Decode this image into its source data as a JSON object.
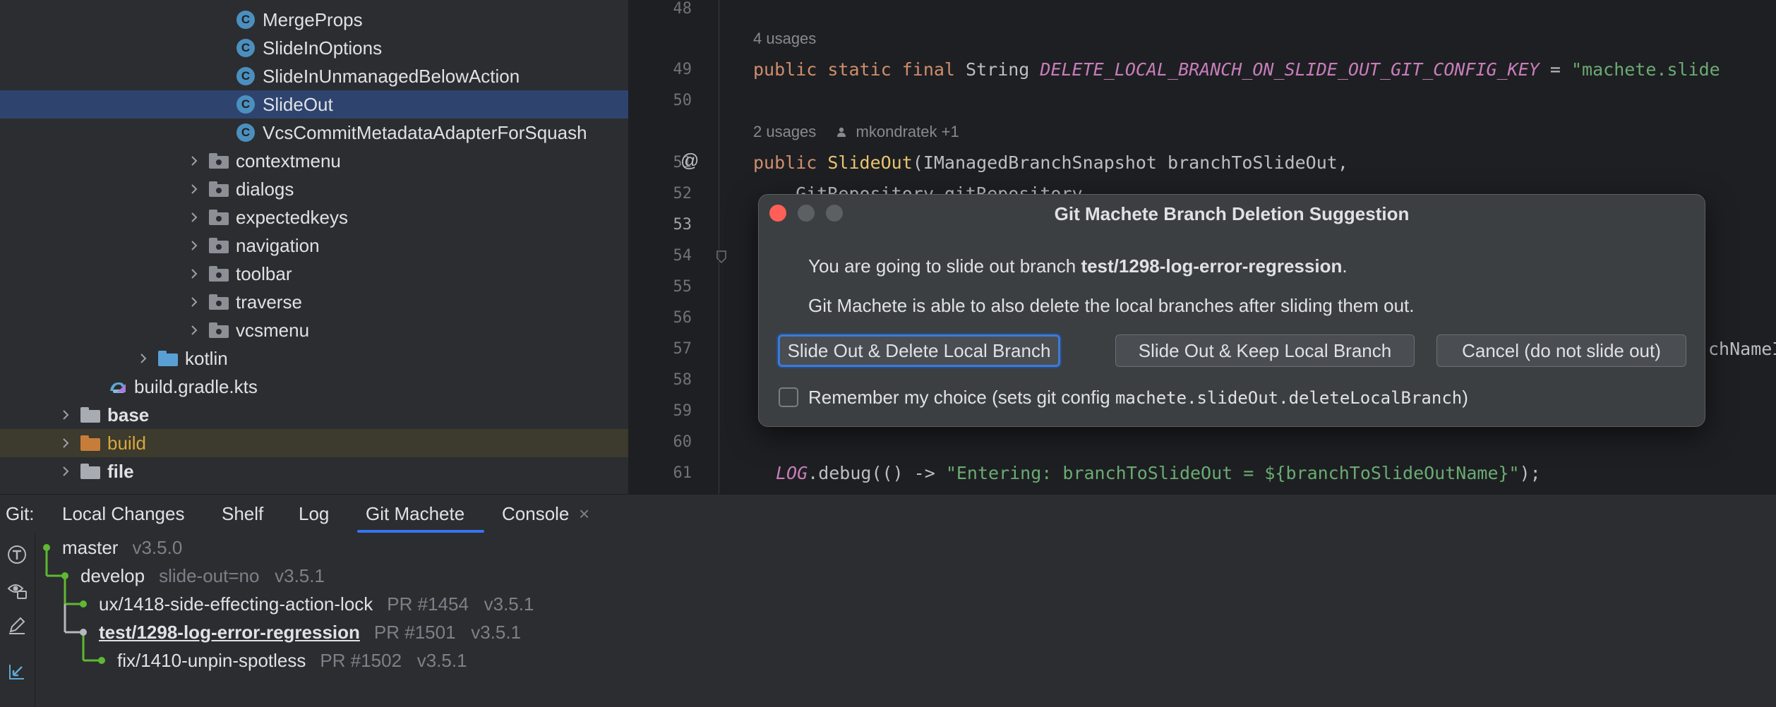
{
  "project_tree": {
    "items": [
      {
        "label": "MergeProps",
        "type": "class"
      },
      {
        "label": "SlideInOptions",
        "type": "class"
      },
      {
        "label": "SlideInUnmanagedBelowAction",
        "type": "class"
      },
      {
        "label": "SlideOut",
        "type": "class",
        "selected": true
      },
      {
        "label": "VcsCommitMetadataAdapterForSquash",
        "type": "class"
      },
      {
        "label": "contextmenu",
        "type": "folder"
      },
      {
        "label": "dialogs",
        "type": "folder"
      },
      {
        "label": "expectedkeys",
        "type": "folder"
      },
      {
        "label": "navigation",
        "type": "folder"
      },
      {
        "label": "toolbar",
        "type": "folder"
      },
      {
        "label": "traverse",
        "type": "folder"
      },
      {
        "label": "vcsmenu",
        "type": "folder"
      },
      {
        "label": "kotlin",
        "type": "source-folder"
      },
      {
        "label": "build.gradle.kts",
        "type": "gradle-file"
      },
      {
        "label": "base",
        "type": "module"
      },
      {
        "label": "build",
        "type": "excluded-folder"
      },
      {
        "label": "file",
        "type": "module"
      }
    ]
  },
  "editor": {
    "line_numbers": [
      "48",
      "49",
      "50",
      "51",
      "52",
      "53",
      "54",
      "55",
      "56",
      "57",
      "58",
      "59",
      "60",
      "61"
    ],
    "current_line": "53",
    "inlay_usages_1": "4 usages",
    "inlay_usages_2": "2 usages",
    "inlay_author": "mkondratek +1",
    "gutter_annotation": "@",
    "line49": {
      "kw1": "public static final",
      "type": " String ",
      "const": "DELETE_LOCAL_BRANCH_ON_SLIDE_OUT_GIT_CONFIG_KEY",
      "eq": " = ",
      "str": "\"machete.slide"
    },
    "line51": {
      "kw": "public ",
      "fn": "SlideOut",
      "rest": "(IManagedBranchSnapshot branchToSlideOut,"
    },
    "line52": "    GitRepository gitRepository,",
    "line57_tail": "chNameI",
    "line61": {
      "log": "LOG",
      "mid": ".debug(() -> ",
      "str": "\"Entering: branchToSlideOut = ${branchToSlideOutName}\"",
      "end": ");"
    }
  },
  "dialog": {
    "title": "Git Machete Branch Deletion Suggestion",
    "message_prefix": "You are going to slide out branch ",
    "message_branch": "test/1298-log-error-regression",
    "message_suffix": ".",
    "message2": "Git Machete is able to also delete the local branches after sliding them out.",
    "buttons": {
      "delete": "Slide Out & Delete Local Branch",
      "keep": "Slide Out & Keep Local Branch",
      "cancel": "Cancel (do not slide out)"
    },
    "remember_prefix": "Remember my choice (sets git config ",
    "remember_key": "machete.slideOut.deleteLocalBranch",
    "remember_suffix": ")",
    "remember_checked": false
  },
  "bottom": {
    "git_label": "Git:",
    "tabs": [
      "Local Changes",
      "Shelf",
      "Log",
      "Git Machete",
      "Console"
    ],
    "active_tab": "Git Machete",
    "console_close": "×",
    "branches": [
      {
        "name": "master",
        "extra": "v3.5.0",
        "depth": 0
      },
      {
        "name": "develop",
        "extra": "slide-out=no   v3.5.1",
        "depth": 1
      },
      {
        "name": "ux/1418-side-effecting-action-lock",
        "extra": "PR #1454   v3.5.1",
        "depth": 2
      },
      {
        "name": "test/1298-log-error-regression",
        "extra": "PR #1501   v3.5.1",
        "depth": 2,
        "current": true
      },
      {
        "name": "fix/1410-unpin-spotless",
        "extra": "PR #1502   v3.5.1",
        "depth": 3
      }
    ]
  },
  "colors": {
    "accent": "#3574f0",
    "selection": "#2e436e",
    "branch_green": "#5fb832",
    "close_red": "#ff5f57"
  }
}
